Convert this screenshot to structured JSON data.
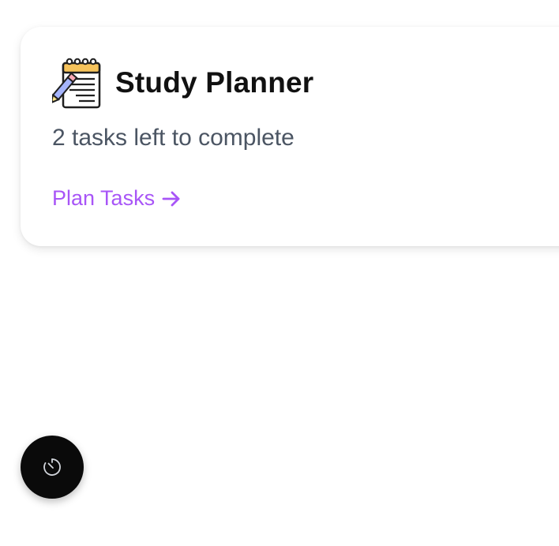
{
  "card": {
    "title": "Study Planner",
    "subtitle": "2 tasks left to complete",
    "link_label": "Plan Tasks",
    "icon": "notepad-pencil-icon",
    "accent_color": "#a855f7"
  },
  "fab": {
    "icon": "timer-icon",
    "background": "#0a0a0a"
  }
}
